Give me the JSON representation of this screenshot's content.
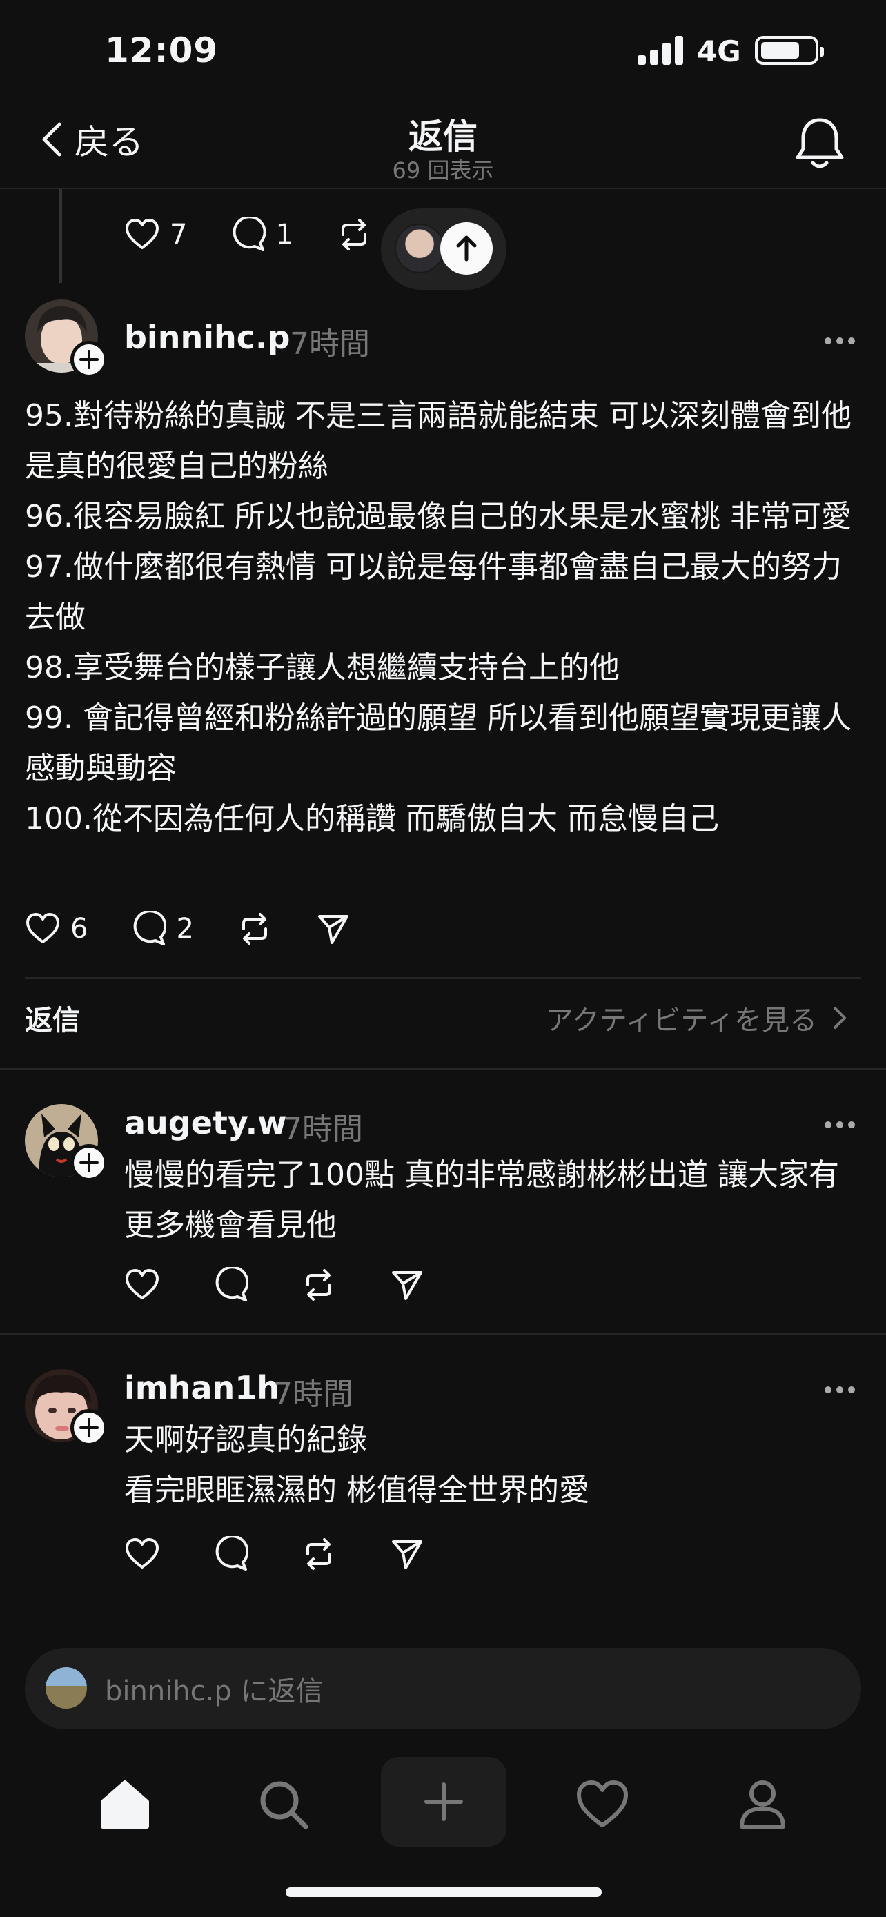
{
  "status_bar": {
    "time": "12:09",
    "network": "4G",
    "battery_level": 0.74
  },
  "nav": {
    "back_label": "戻る",
    "title": "返信",
    "subtitle": "69 回表示"
  },
  "parent_actions": {
    "likes": "7",
    "replies": "1"
  },
  "main_post": {
    "username": "binnihc.p",
    "time": "7時間",
    "text": "95.對待粉絲的真誠 不是三言兩語就能結束 可以深刻體會到他是真的很愛自己的粉絲\n96.很容易臉紅 所以也說過最像自己的水果是水蜜桃 非常可愛\n97.做什麼都很有熱情 可以說是每件事都會盡自己最大的努力去做\n98.享受舞台的樣子讓人想繼續支持台上的他\n99. 會記得曾經和粉絲許過的願望 所以看到他願望實現更讓人感動與動容\n100.從不因為任何人的稱讚 而驕傲自大 而怠慢自己",
    "likes": "6",
    "replies": "2"
  },
  "replies_section": {
    "header": "返信",
    "activity_link": "アクティビティを見る"
  },
  "replies": [
    {
      "username": "augety.w",
      "time": "7時間",
      "text": "慢慢的看完了100點 真的非常感謝彬彬出道 讓大家有更多機會看見他"
    },
    {
      "username": "imhan1h",
      "time": "7時間",
      "text": "天啊好認真的紀錄\n看完眼眶濕濕的 彬值得全世界的愛"
    }
  ],
  "composer": {
    "placeholder": "binnihc.p に返信"
  },
  "icons": {
    "back": "chevron-left-icon",
    "notifications": "bell-icon",
    "like": "heart-icon",
    "reply": "comment-icon",
    "repost": "repost-icon",
    "share": "send-icon",
    "more": "more-icon",
    "follow": "plus-icon",
    "home": "home-icon",
    "search": "search-icon",
    "compose": "plus-icon",
    "activity": "heart-icon",
    "profile": "person-icon"
  },
  "colors": {
    "background": "#101010",
    "text": "#f3f5f7",
    "muted": "#777777",
    "divider": "#262626"
  }
}
